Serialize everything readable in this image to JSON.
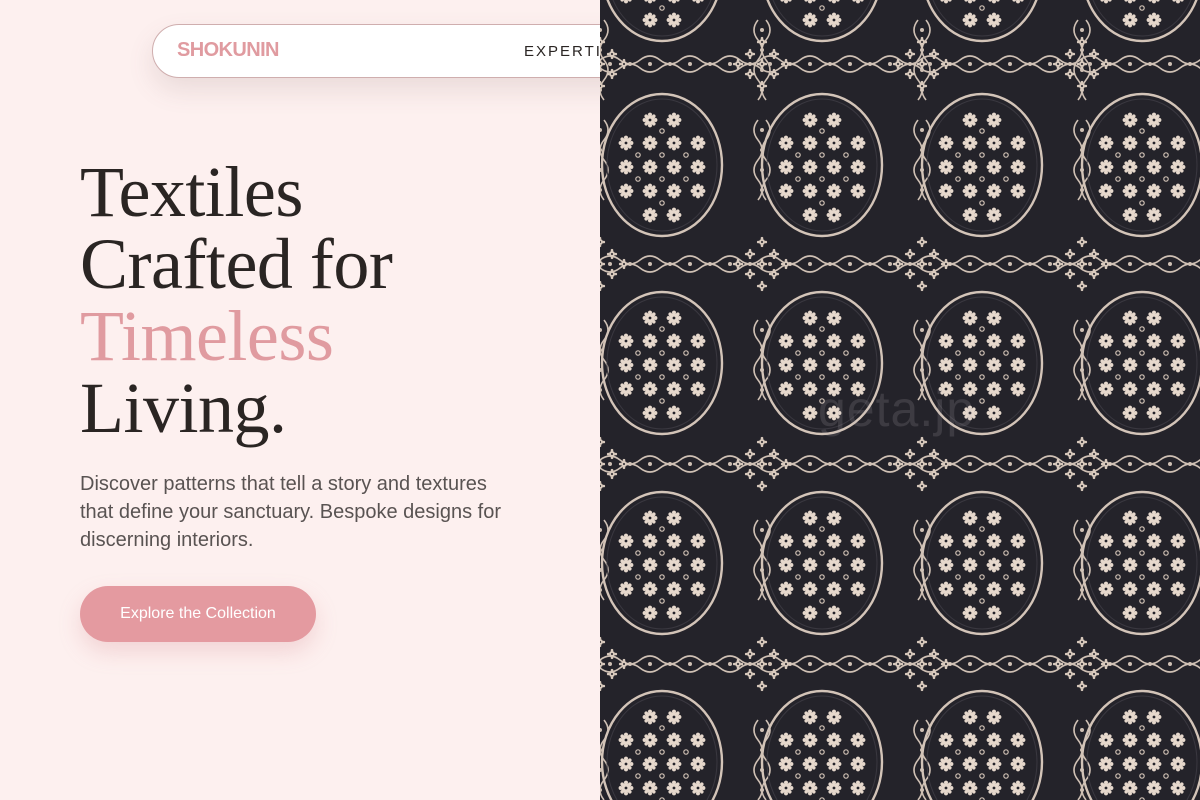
{
  "nav": {
    "logo": "SHOKUNIN",
    "link_expertise": "EXPERTISE"
  },
  "hero": {
    "headline_line1": "Textiles",
    "headline_line2": "Crafted for",
    "headline_line3": "Timeless",
    "headline_line4": "Living.",
    "description": "Discover patterns that tell a story and textures that define your sanctuary. Bespoke designs for discerning interiors.",
    "cta_label": "Explore the Collection"
  },
  "textile_image": {
    "watermark": "geta.jp"
  },
  "colors": {
    "background": "#fdf0ef",
    "accent": "#e09ba0",
    "text": "#2a2523",
    "textile_dark": "#24232a",
    "textile_light": "#e6d8cc"
  }
}
